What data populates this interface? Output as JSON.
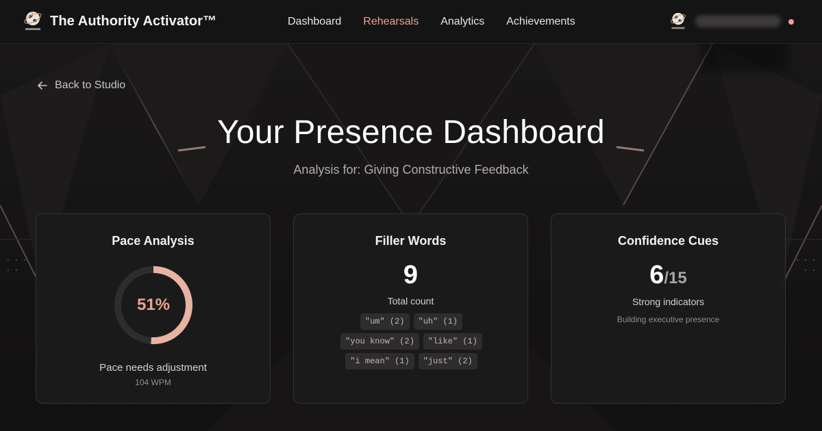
{
  "app": {
    "brand_name": "The Authority Activator™",
    "logo_icon": "globe-logo-icon"
  },
  "nav": {
    "items": [
      {
        "label": "Dashboard",
        "active": false
      },
      {
        "label": "Rehearsals",
        "active": true
      },
      {
        "label": "Analytics",
        "active": false
      },
      {
        "label": "Achievements",
        "active": false
      }
    ]
  },
  "user": {
    "avatar_icon": "globe-logo-icon",
    "status_color": "#e8a48f"
  },
  "page": {
    "back_label": "Back to Studio",
    "title": "Your Presence Dashboard",
    "subtitle": "Analysis for: Giving Constructive Feedback"
  },
  "pace": {
    "title": "Pace Analysis",
    "percent": 51,
    "percent_label": "51%",
    "status": "Pace needs adjustment",
    "wpm": "104 WPM"
  },
  "filler": {
    "title": "Filler Words",
    "count": "9",
    "count_label": "Total count",
    "tags": [
      "\"um\" (2)",
      "\"uh\" (1)",
      "\"you know\" (2)",
      "\"like\" (1)",
      "\"i mean\" (1)",
      "\"just\" (2)"
    ]
  },
  "confidence": {
    "title": "Confidence Cues",
    "value": "6",
    "total": "15",
    "separator": "/",
    "label": "Strong indicators",
    "sub": "Building executive presence"
  },
  "colors": {
    "accent": "#e8a48f",
    "background": "#141314",
    "card": "#1c1b1c",
    "track": "#2e2c2d"
  }
}
